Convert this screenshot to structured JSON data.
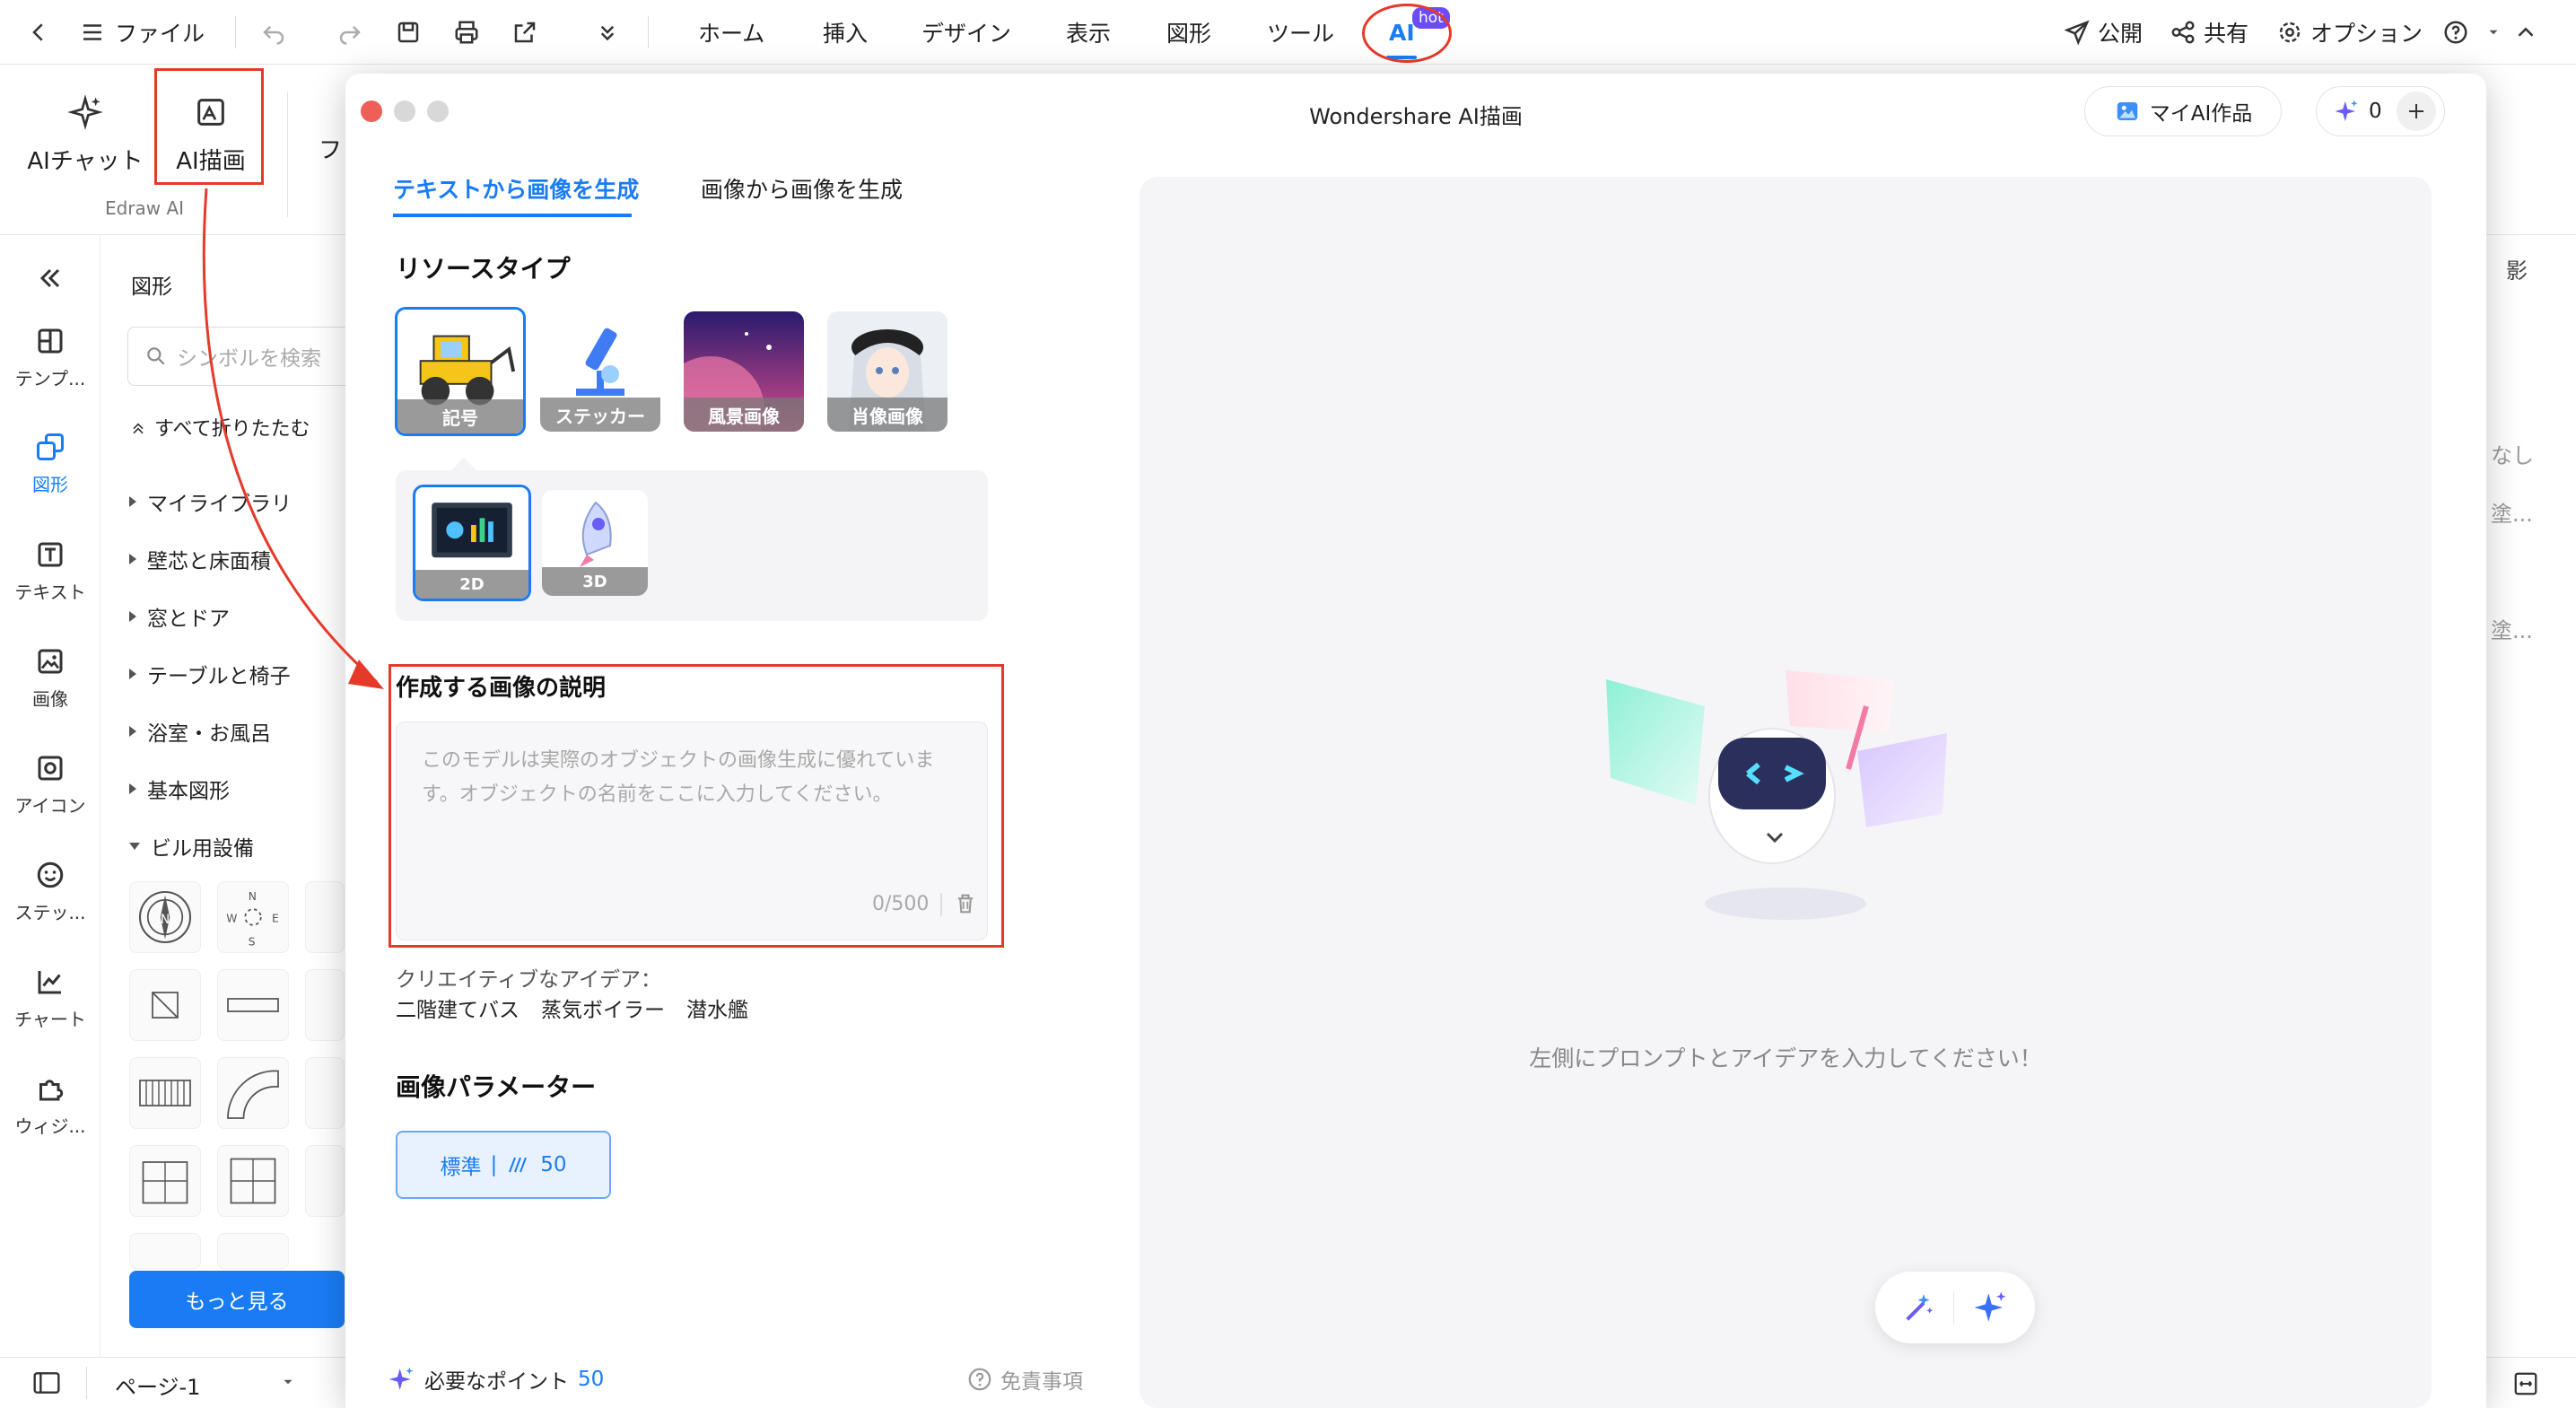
{
  "topbar": {
    "file_label": "ファイル",
    "menus": [
      "ホーム",
      "挿入",
      "デザイン",
      "表示",
      "図形",
      "ツール",
      "AI"
    ],
    "ai_badge": "hot",
    "publish_label": "公開",
    "share_label": "共有",
    "options_label": "オプション"
  },
  "ribbon": {
    "ai_chat_label": "AIチャット",
    "ai_draw_label": "AI描画",
    "truncated_label": "フ",
    "group_label": "Edraw AI"
  },
  "rail": {
    "items": [
      {
        "label": "テンプ...",
        "icon": "template-icon"
      },
      {
        "label": "図形",
        "icon": "shapes-icon"
      },
      {
        "label": "テキスト",
        "icon": "text-icon"
      },
      {
        "label": "画像",
        "icon": "image-icon"
      },
      {
        "label": "アイコン",
        "icon": "icon-library-icon"
      },
      {
        "label": "ステッ...",
        "icon": "sticker-icon"
      },
      {
        "label": "チャート",
        "icon": "chart-icon"
      },
      {
        "label": "ウィジ...",
        "icon": "widget-icon"
      }
    ]
  },
  "panel": {
    "title": "図形",
    "search_placeholder": "シンボルを検索",
    "collapse_all": "すべて折りたたむ",
    "categories": [
      "マイライブラリ",
      "壁芯と床面積",
      "窓とドア",
      "テーブルと椅子",
      "浴室・お風呂",
      "基本図形",
      "ビル用設備"
    ],
    "more_button": "もっと見る"
  },
  "bottombar": {
    "page_label": "ページ-1"
  },
  "right_peek": {
    "shadow_label": "影",
    "t1": "なし",
    "t2": "塗...",
    "t3": "塗..."
  },
  "modal": {
    "title": "Wondershare AI描画",
    "my_works_label": "マイAI作品",
    "credits": "0",
    "tabs": [
      "テキストから画像を生成",
      "画像から画像を生成"
    ],
    "resource_type_title": "リソースタイプ",
    "resource_types": [
      "記号",
      "ステッカー",
      "風景画像",
      "肖像画像"
    ],
    "sub_types": [
      "2D",
      "3D"
    ],
    "description_title": "作成する画像の説明",
    "description_placeholder": "このモデルは実際のオブジェクトの画像生成に優れています。オブジェクトの名前をここに入力してください。",
    "char_count": "0/500",
    "creative_ideas_label": "クリエイティブなアイデア：",
    "ideas": [
      "二階建てバス",
      "蒸気ボイラー",
      "潜水艦"
    ],
    "params_title": "画像パラメーター",
    "param_quality": "標準",
    "param_value": "50",
    "required_points_label": "必要なポイント",
    "required_points_value": "50",
    "disclaimer_label": "免責事項",
    "empty_hint": "左側にプロンプトとアイデアを入力してください！"
  },
  "colors": {
    "accent": "#1a7cf5",
    "annotation_red": "#e53a2a",
    "mac_close": "#ee5f57"
  }
}
